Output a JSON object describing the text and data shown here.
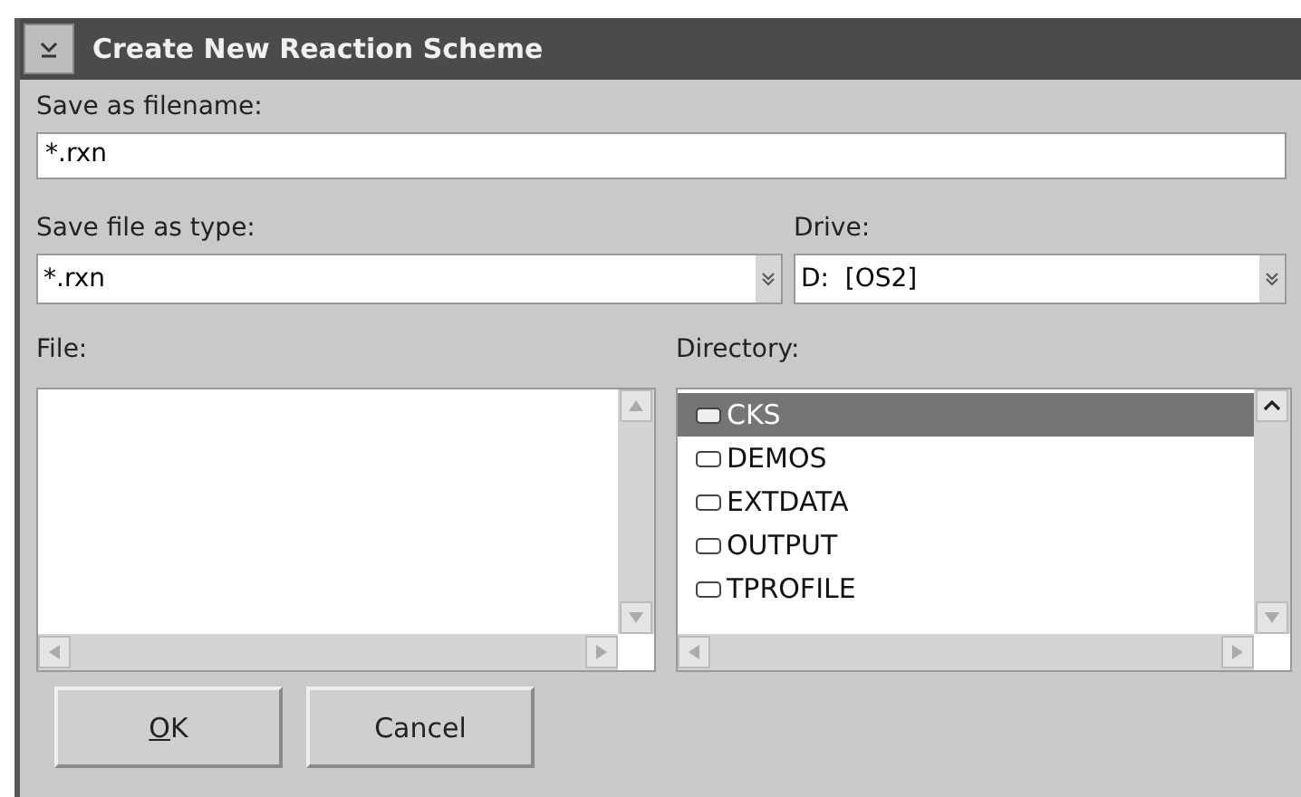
{
  "window": {
    "title": "Create New Reaction Scheme"
  },
  "filename": {
    "label": "Save as filename:",
    "value": "*.rxn"
  },
  "file_type": {
    "label": "Save file as type:",
    "value": "*.rxn"
  },
  "drive": {
    "label": "Drive:",
    "value": "D:  [OS2]"
  },
  "file_list": {
    "label": "File:"
  },
  "directory": {
    "label": "Directory:",
    "items": [
      {
        "name": "CKS",
        "selected": true
      },
      {
        "name": "DEMOS",
        "selected": false
      },
      {
        "name": "EXTDATA",
        "selected": false
      },
      {
        "name": "OUTPUT",
        "selected": false
      },
      {
        "name": "TPROFILE",
        "selected": false
      }
    ]
  },
  "buttons": [
    {
      "label": "OK",
      "underline_first": true
    },
    {
      "label": "Cancel",
      "underline_first": false
    }
  ]
}
